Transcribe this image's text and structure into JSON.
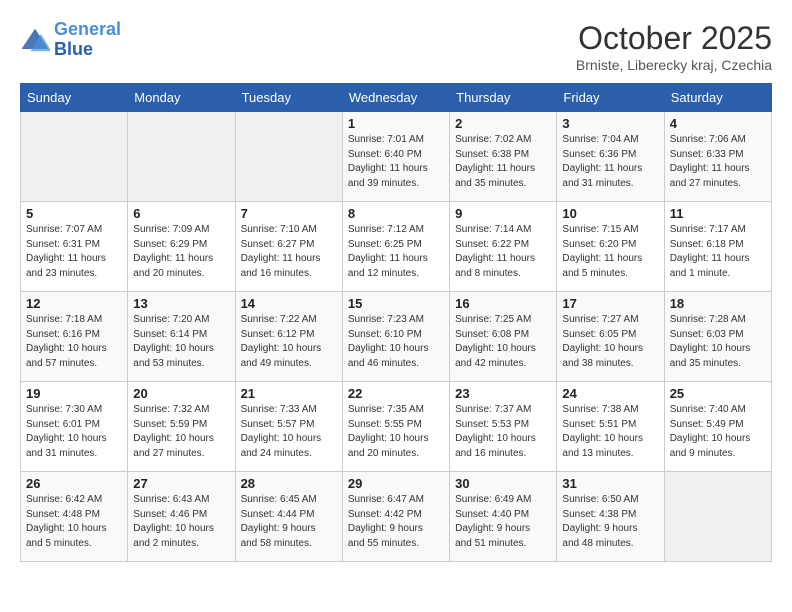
{
  "header": {
    "logo_line1": "General",
    "logo_line2": "Blue",
    "month": "October 2025",
    "location": "Brniste, Liberecky kraj, Czechia"
  },
  "weekdays": [
    "Sunday",
    "Monday",
    "Tuesday",
    "Wednesday",
    "Thursday",
    "Friday",
    "Saturday"
  ],
  "weeks": [
    [
      {
        "day": "",
        "content": ""
      },
      {
        "day": "",
        "content": ""
      },
      {
        "day": "",
        "content": ""
      },
      {
        "day": "1",
        "content": "Sunrise: 7:01 AM\nSunset: 6:40 PM\nDaylight: 11 hours\nand 39 minutes."
      },
      {
        "day": "2",
        "content": "Sunrise: 7:02 AM\nSunset: 6:38 PM\nDaylight: 11 hours\nand 35 minutes."
      },
      {
        "day": "3",
        "content": "Sunrise: 7:04 AM\nSunset: 6:36 PM\nDaylight: 11 hours\nand 31 minutes."
      },
      {
        "day": "4",
        "content": "Sunrise: 7:06 AM\nSunset: 6:33 PM\nDaylight: 11 hours\nand 27 minutes."
      }
    ],
    [
      {
        "day": "5",
        "content": "Sunrise: 7:07 AM\nSunset: 6:31 PM\nDaylight: 11 hours\nand 23 minutes."
      },
      {
        "day": "6",
        "content": "Sunrise: 7:09 AM\nSunset: 6:29 PM\nDaylight: 11 hours\nand 20 minutes."
      },
      {
        "day": "7",
        "content": "Sunrise: 7:10 AM\nSunset: 6:27 PM\nDaylight: 11 hours\nand 16 minutes."
      },
      {
        "day": "8",
        "content": "Sunrise: 7:12 AM\nSunset: 6:25 PM\nDaylight: 11 hours\nand 12 minutes."
      },
      {
        "day": "9",
        "content": "Sunrise: 7:14 AM\nSunset: 6:22 PM\nDaylight: 11 hours\nand 8 minutes."
      },
      {
        "day": "10",
        "content": "Sunrise: 7:15 AM\nSunset: 6:20 PM\nDaylight: 11 hours\nand 5 minutes."
      },
      {
        "day": "11",
        "content": "Sunrise: 7:17 AM\nSunset: 6:18 PM\nDaylight: 11 hours\nand 1 minute."
      }
    ],
    [
      {
        "day": "12",
        "content": "Sunrise: 7:18 AM\nSunset: 6:16 PM\nDaylight: 10 hours\nand 57 minutes."
      },
      {
        "day": "13",
        "content": "Sunrise: 7:20 AM\nSunset: 6:14 PM\nDaylight: 10 hours\nand 53 minutes."
      },
      {
        "day": "14",
        "content": "Sunrise: 7:22 AM\nSunset: 6:12 PM\nDaylight: 10 hours\nand 49 minutes."
      },
      {
        "day": "15",
        "content": "Sunrise: 7:23 AM\nSunset: 6:10 PM\nDaylight: 10 hours\nand 46 minutes."
      },
      {
        "day": "16",
        "content": "Sunrise: 7:25 AM\nSunset: 6:08 PM\nDaylight: 10 hours\nand 42 minutes."
      },
      {
        "day": "17",
        "content": "Sunrise: 7:27 AM\nSunset: 6:05 PM\nDaylight: 10 hours\nand 38 minutes."
      },
      {
        "day": "18",
        "content": "Sunrise: 7:28 AM\nSunset: 6:03 PM\nDaylight: 10 hours\nand 35 minutes."
      }
    ],
    [
      {
        "day": "19",
        "content": "Sunrise: 7:30 AM\nSunset: 6:01 PM\nDaylight: 10 hours\nand 31 minutes."
      },
      {
        "day": "20",
        "content": "Sunrise: 7:32 AM\nSunset: 5:59 PM\nDaylight: 10 hours\nand 27 minutes."
      },
      {
        "day": "21",
        "content": "Sunrise: 7:33 AM\nSunset: 5:57 PM\nDaylight: 10 hours\nand 24 minutes."
      },
      {
        "day": "22",
        "content": "Sunrise: 7:35 AM\nSunset: 5:55 PM\nDaylight: 10 hours\nand 20 minutes."
      },
      {
        "day": "23",
        "content": "Sunrise: 7:37 AM\nSunset: 5:53 PM\nDaylight: 10 hours\nand 16 minutes."
      },
      {
        "day": "24",
        "content": "Sunrise: 7:38 AM\nSunset: 5:51 PM\nDaylight: 10 hours\nand 13 minutes."
      },
      {
        "day": "25",
        "content": "Sunrise: 7:40 AM\nSunset: 5:49 PM\nDaylight: 10 hours\nand 9 minutes."
      }
    ],
    [
      {
        "day": "26",
        "content": "Sunrise: 6:42 AM\nSunset: 4:48 PM\nDaylight: 10 hours\nand 5 minutes."
      },
      {
        "day": "27",
        "content": "Sunrise: 6:43 AM\nSunset: 4:46 PM\nDaylight: 10 hours\nand 2 minutes."
      },
      {
        "day": "28",
        "content": "Sunrise: 6:45 AM\nSunset: 4:44 PM\nDaylight: 9 hours\nand 58 minutes."
      },
      {
        "day": "29",
        "content": "Sunrise: 6:47 AM\nSunset: 4:42 PM\nDaylight: 9 hours\nand 55 minutes."
      },
      {
        "day": "30",
        "content": "Sunrise: 6:49 AM\nSunset: 4:40 PM\nDaylight: 9 hours\nand 51 minutes."
      },
      {
        "day": "31",
        "content": "Sunrise: 6:50 AM\nSunset: 4:38 PM\nDaylight: 9 hours\nand 48 minutes."
      },
      {
        "day": "",
        "content": ""
      }
    ]
  ]
}
